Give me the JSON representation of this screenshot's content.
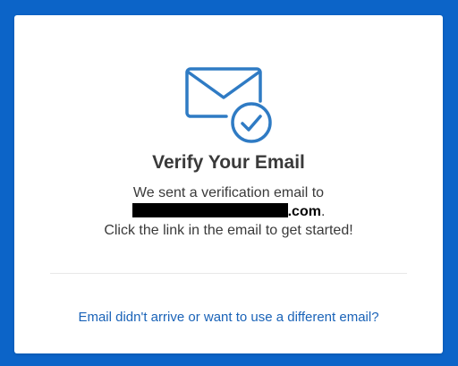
{
  "colors": {
    "background": "#0c64c8",
    "card": "#ffffff",
    "accent": "#2f7bc4",
    "link": "#1a63b8",
    "text": "#3a3a3a"
  },
  "icon": {
    "name": "envelope-check-icon"
  },
  "title": "Verify Your Email",
  "message": {
    "line1": "We sent a verification email to",
    "domain_suffix": ".com",
    "period": ".",
    "line3": "Click the link in the email to get started!"
  },
  "links": {
    "different_email": "Email didn't arrive or want to use a different email?"
  }
}
